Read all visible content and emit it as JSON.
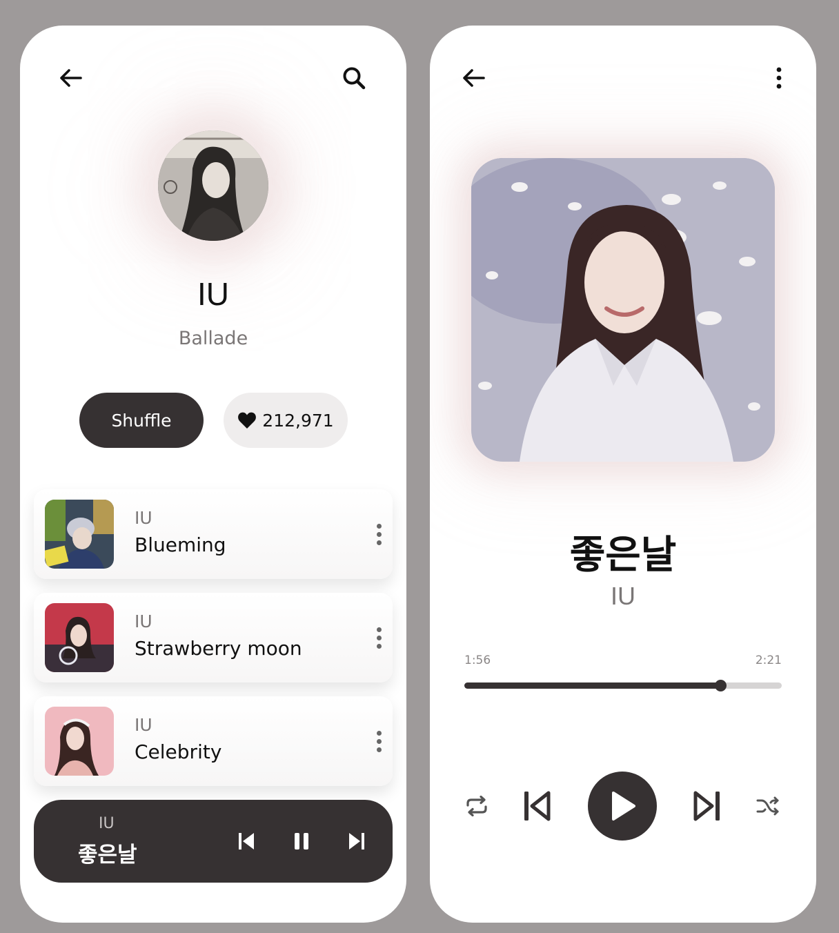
{
  "artist_screen": {
    "artist_name": "IU",
    "genre": "Ballade",
    "shuffle_label": "Shuffle",
    "likes_count": "212,971",
    "icons": {
      "back": "arrow-left-icon",
      "search": "search-icon",
      "heart": "heart-icon",
      "more": "more-vertical-icon"
    },
    "tracks": [
      {
        "artist": "IU",
        "title": "Blueming"
      },
      {
        "artist": "IU",
        "title": "Strawberry moon"
      },
      {
        "artist": "IU",
        "title": "Celebrity"
      }
    ],
    "mini_player": {
      "artist": "IU",
      "title": "좋은날",
      "icons": [
        "skip-previous-icon",
        "pause-icon",
        "skip-next-icon"
      ]
    }
  },
  "now_playing_screen": {
    "title": "좋은날",
    "artist": "IU",
    "current_time": "1:56",
    "total_time": "2:21",
    "progress": 0.806,
    "icons": {
      "back": "arrow-left-icon",
      "more": "more-vertical-icon",
      "repeat": "repeat-icon",
      "previous": "skip-previous-icon",
      "play": "play-icon",
      "next": "skip-next-icon",
      "shuffle": "shuffle-icon"
    }
  },
  "colors": {
    "background": "#9e9a9a",
    "card": "#ffffff",
    "dark_accent": "#363132",
    "muted_text": "#7a7676",
    "light_pill": "#efeded"
  }
}
